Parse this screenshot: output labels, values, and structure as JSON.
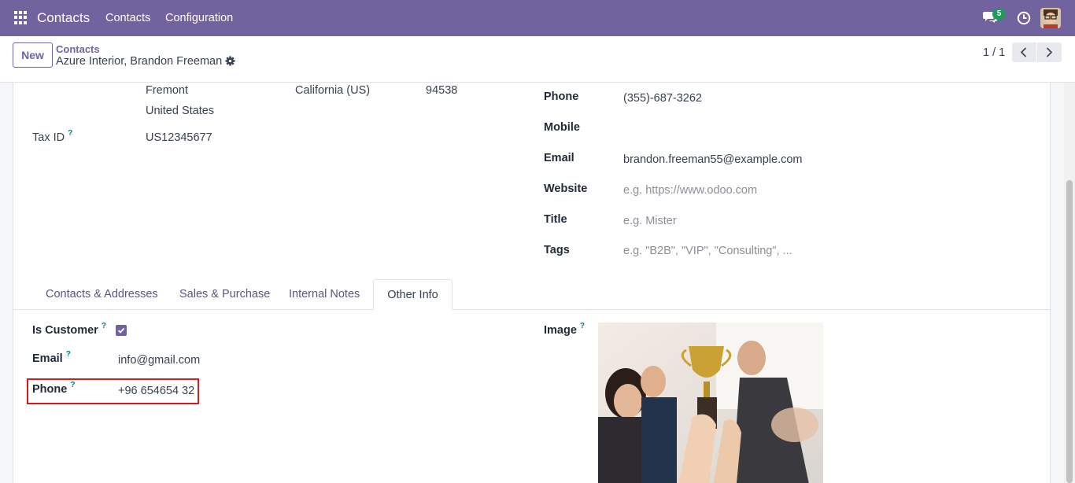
{
  "navbar": {
    "app_name": "Contacts",
    "menus": [
      "Contacts",
      "Configuration"
    ],
    "chat_count": "5",
    "brand_color": "#71639e"
  },
  "control": {
    "new_label": "New",
    "breadcrumb_parent": "Contacts",
    "breadcrumb_current": "Azure Interior, Brandon Freeman",
    "pager": "1 / 1"
  },
  "address": {
    "city": "Fremont",
    "state": "California (US)",
    "zip": "94538",
    "country": "United States"
  },
  "tax": {
    "label": "Tax ID",
    "help": "?",
    "value": "US12345677"
  },
  "contact_fields": {
    "phone_label": "Phone",
    "phone_value": "(355)-687-3262",
    "mobile_label": "Mobile",
    "email_label": "Email",
    "email_value": "brandon.freeman55@example.com",
    "website_label": "Website",
    "website_placeholder": "e.g. https://www.odoo.com",
    "title_label": "Title",
    "title_placeholder": "e.g. Mister",
    "tags_label": "Tags",
    "tags_placeholder": "e.g. \"B2B\", \"VIP\", \"Consulting\", ..."
  },
  "tabs": [
    {
      "label": "Contacts & Addresses",
      "active": false
    },
    {
      "label": "Sales & Purchase",
      "active": false
    },
    {
      "label": "Internal Notes",
      "active": false
    },
    {
      "label": "Other Info",
      "active": true
    }
  ],
  "other_info": {
    "is_customer_label": "Is Customer",
    "is_customer_checked": true,
    "email_label": "Email",
    "email_value": "info@gmail.com",
    "phone_label": "Phone",
    "phone_value": "+96 654654 32",
    "image_label": "Image",
    "help": "?"
  },
  "highlight_color": "#e0161d"
}
